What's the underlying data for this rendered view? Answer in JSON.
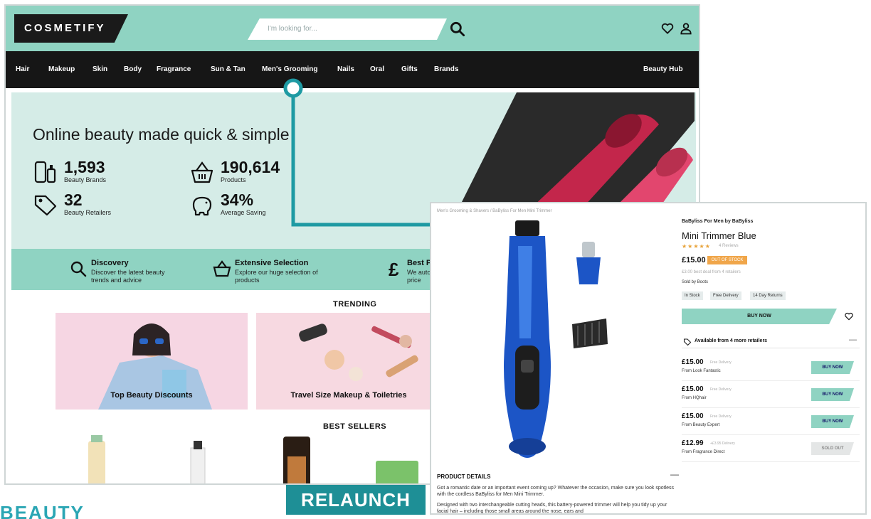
{
  "colors": {
    "mint": "#8fd3c2",
    "pale_mint": "#d5ece7",
    "teal": "#1e8f96",
    "nav": "#161616",
    "accent_orange": "#f0a64a"
  },
  "header": {
    "logo": "COSMETIFY",
    "search_placeholder": "I'm looking for...",
    "icons": [
      "search-icon",
      "heart-icon",
      "user-icon"
    ]
  },
  "nav": {
    "items": [
      "Hair",
      "Makeup",
      "Skin",
      "Body",
      "Fragrance",
      "Sun & Tan",
      "Men's Grooming",
      "Nails",
      "Oral",
      "Gifts",
      "Brands"
    ],
    "right": "Beauty Hub"
  },
  "hero": {
    "title": "Online beauty made quick & simple",
    "stats": [
      {
        "value": "1,593",
        "label": "Beauty Brands",
        "icon": "bottles-icon"
      },
      {
        "value": "190,614",
        "label": "Products",
        "icon": "basket-icon"
      },
      {
        "value": "32",
        "label": "Beauty Retailers",
        "icon": "tag-icon"
      },
      {
        "value": "34%",
        "label": "Average Saving",
        "icon": "piggy-bank-icon"
      }
    ]
  },
  "features": [
    {
      "title": "Discovery",
      "desc": "Discover the latest beauty trends and advice",
      "icon": "search-icon"
    },
    {
      "title": "Extensive Selection",
      "desc": "Explore our huge selection of products",
      "icon": "basket-icon"
    },
    {
      "title": "Best Price",
      "desc": "We automatically find the best price",
      "icon": "pound-icon"
    }
  ],
  "sections": {
    "trending": "TRENDING",
    "best_sellers": "BEST SELLERS"
  },
  "tiles": [
    "Top Beauty Discounts",
    "Travel Size Makeup & Toiletries"
  ],
  "product": {
    "breadcrumb": "Men's Grooming & Shavers  /  BaByliss For Men Mini Trimmer",
    "brand": "BaByliss For Men by BaByliss",
    "title": "Mini Trimmer Blue",
    "stars": "★★★★★",
    "reviews": "4 Reviews",
    "price": "£15.00",
    "price_pill": "OUT OF STOCK",
    "price_note": "£3.00 best deal from 4 retailers",
    "sold_by": "Sold by Boots",
    "chips": [
      "In Stock",
      "Free Delivery",
      "14 Day Returns"
    ],
    "buy_label": "BUY NOW",
    "available": "Available from 4 more retailers",
    "details_heading": "PRODUCT DETAILS",
    "details_1": "Got a romantic date or an important event coming up? Whatever the occasion, make sure you look spotless with the cordless BaByliss for Men Mini Trimmer.",
    "details_2": "Designed with two interchangeable cutting heads, this battery-powered trimmer will help you tidy up your facial hair – including those small areas around the nose, ears and",
    "offers": [
      {
        "price": "£15.00",
        "delivery": "Free Delivery",
        "from": "From Look Fantastic",
        "button": "BUY NOW",
        "active": true
      },
      {
        "price": "£15.00",
        "delivery": "Free Delivery",
        "from": "From HQhair",
        "button": "BUY NOW",
        "active": true
      },
      {
        "price": "£15.00",
        "delivery": "Free Delivery",
        "from": "From Beauty Expert",
        "button": "BUY NOW",
        "active": true
      },
      {
        "price": "£12.99",
        "delivery": "+£3.95 Delivery",
        "from": "From Fragrance Direct",
        "button": "SOLD OUT",
        "active": false
      }
    ]
  },
  "labels": {
    "relaunch": "RELAUNCH",
    "beauty": "BEAUTY"
  }
}
